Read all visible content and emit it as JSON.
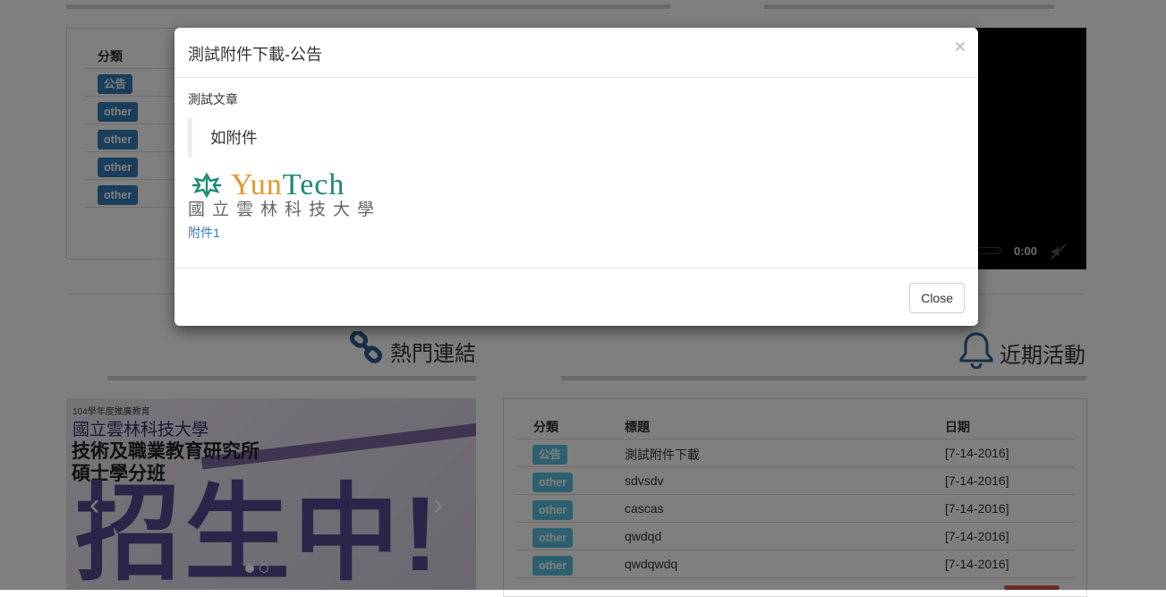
{
  "left_panel": {
    "header_category": "分類",
    "rows": [
      {
        "tag": "公告"
      },
      {
        "tag": "other"
      },
      {
        "tag": "other"
      },
      {
        "tag": "other"
      },
      {
        "tag": "other"
      }
    ]
  },
  "video": {
    "time": "0:00"
  },
  "sections": {
    "links_title": "熱門連結",
    "events_title": "近期活動"
  },
  "banner": {
    "small": "104學年度推廣教育",
    "line1": "國立雲林科技大學",
    "line2": "技術及職業教育研究所",
    "line3": "碩士學分班",
    "big": "招生中!"
  },
  "events_table": {
    "headers": {
      "category": "分類",
      "title": "標題",
      "date": "日期"
    },
    "rows": [
      {
        "tag": "公告",
        "title": "測試附件下載",
        "date": "[7-14-2016]"
      },
      {
        "tag": "other",
        "title": "sdvsdv",
        "date": "[7-14-2016]"
      },
      {
        "tag": "other",
        "title": "cascas",
        "date": "[7-14-2016]"
      },
      {
        "tag": "other",
        "title": "qwdqd",
        "date": "[7-14-2016]"
      },
      {
        "tag": "other",
        "title": "qwdqwdq",
        "date": "[7-14-2016]"
      }
    ]
  },
  "modal": {
    "title": "測試附件下載-公告",
    "close_x": "×",
    "article_label": "測試文章",
    "quote": "如附件",
    "logo_en_a": "Yun",
    "logo_en_b": "Tech",
    "logo_cn": "國立雲林科技大學",
    "attachment": "附件1",
    "close_button": "Close"
  },
  "colors": {
    "primary_label": "#337ab7",
    "info_label": "#5bc0de",
    "link": "#337ab7",
    "backdrop": "rgba(0,0,0,0.5)"
  },
  "icons": [
    "link-icon",
    "bell-icon",
    "mute-icon",
    "chevron-left-icon",
    "chevron-right-icon",
    "yuntech-logo-icon"
  ]
}
